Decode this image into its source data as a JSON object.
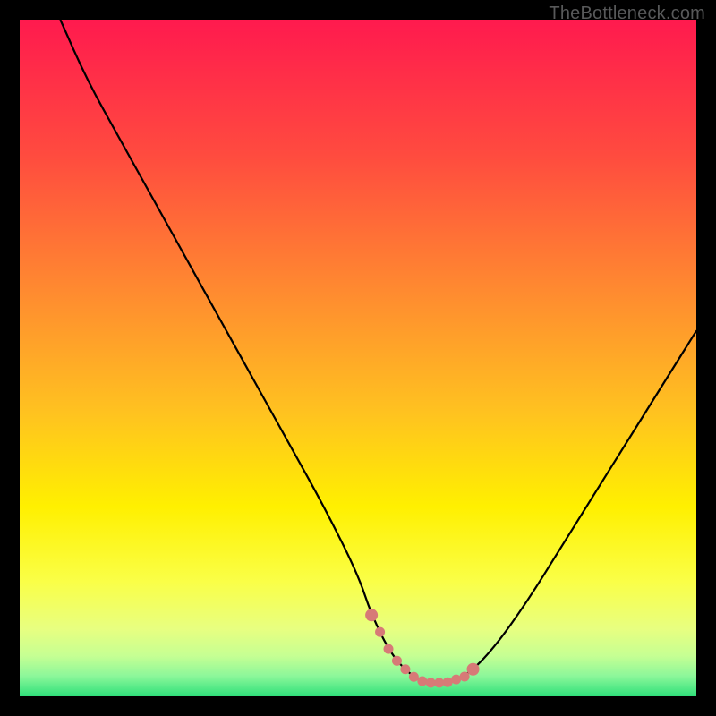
{
  "watermark": "TheBottleneck.com",
  "chart_data": {
    "type": "line",
    "title": "",
    "xlabel": "",
    "ylabel": "",
    "xlim": [
      0,
      100
    ],
    "ylim": [
      0,
      100
    ],
    "series": [
      {
        "name": "bottleneck-curve",
        "x": [
          6,
          10,
          15,
          20,
          25,
          30,
          35,
          40,
          45,
          50,
          52,
          55,
          58,
          60,
          63,
          66,
          70,
          75,
          80,
          85,
          90,
          95,
          100
        ],
        "values": [
          100,
          91,
          82,
          73,
          64,
          55,
          46,
          37,
          28,
          18,
          12,
          6,
          3,
          2,
          2,
          3,
          7,
          14,
          22,
          30,
          38,
          46,
          54
        ]
      }
    ],
    "highlight_range_x": [
      52,
      67
    ],
    "highlight_color": "#d77a77",
    "gradient_stops": [
      {
        "offset": 0.0,
        "color": "#ff1a4e"
      },
      {
        "offset": 0.2,
        "color": "#ff4b3f"
      },
      {
        "offset": 0.4,
        "color": "#ff8a30"
      },
      {
        "offset": 0.58,
        "color": "#ffc220"
      },
      {
        "offset": 0.72,
        "color": "#fff000"
      },
      {
        "offset": 0.83,
        "color": "#faff47"
      },
      {
        "offset": 0.9,
        "color": "#e8ff80"
      },
      {
        "offset": 0.94,
        "color": "#c6ff93"
      },
      {
        "offset": 0.97,
        "color": "#8cf79a"
      },
      {
        "offset": 1.0,
        "color": "#2fe07a"
      }
    ]
  }
}
